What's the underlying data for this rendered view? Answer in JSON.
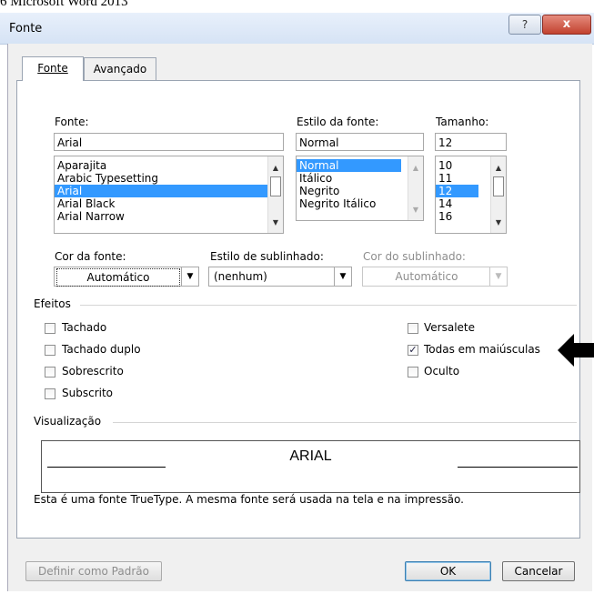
{
  "caption": "6 Microsoft Word 2013",
  "window": {
    "title": "Fonte",
    "help_icon": "?",
    "close_icon": "x"
  },
  "tabs": [
    {
      "label": "Fonte"
    },
    {
      "label": "Avançado"
    }
  ],
  "font": {
    "label": "Fonte:",
    "value": "Arial",
    "items": [
      "Aparajita",
      "Arabic Typesetting",
      "Arial",
      "Arial Black",
      "Arial Narrow"
    ],
    "selected": "Arial"
  },
  "style": {
    "label": "Estilo da fonte:",
    "value": "Normal",
    "items": [
      "Normal",
      "Itálico",
      "Negrito",
      "Negrito Itálico"
    ],
    "selected": "Normal"
  },
  "size": {
    "label": "Tamanho:",
    "value": "12",
    "items": [
      "10",
      "11",
      "12",
      "14",
      "16"
    ],
    "selected": "12"
  },
  "font_color": {
    "label": "Cor da fonte:",
    "value": "Automático"
  },
  "underline_style": {
    "label": "Estilo de sublinhado:",
    "value": "(nenhum)"
  },
  "underline_color": {
    "label": "Cor do sublinhado:",
    "value": "Automático"
  },
  "effects": {
    "label": "Efeitos",
    "strikethrough": {
      "label": "Tachado",
      "checked": false
    },
    "double_strikethrough": {
      "label": "Tachado duplo",
      "checked": false
    },
    "superscript": {
      "label": "Sobrescrito",
      "checked": false
    },
    "subscript": {
      "label": "Subscrito",
      "checked": false
    },
    "small_caps": {
      "label": "Versalete",
      "checked": false
    },
    "all_caps": {
      "label": "Todas em maiúsculas",
      "checked": true
    },
    "hidden": {
      "label": "Oculto",
      "checked": false
    }
  },
  "preview": {
    "label": "Visualização",
    "sample_text": "ARIAL",
    "note": "Esta é uma fonte TrueType. A mesma fonte será usada na tela e na impressão."
  },
  "buttons": {
    "set_default": "Definir como Padrão",
    "ok": "OK",
    "cancel": "Cancelar"
  },
  "colors": {
    "selection": "#3399ff",
    "title_bar": "#d6e3f5",
    "close_button": "#c2422f"
  }
}
